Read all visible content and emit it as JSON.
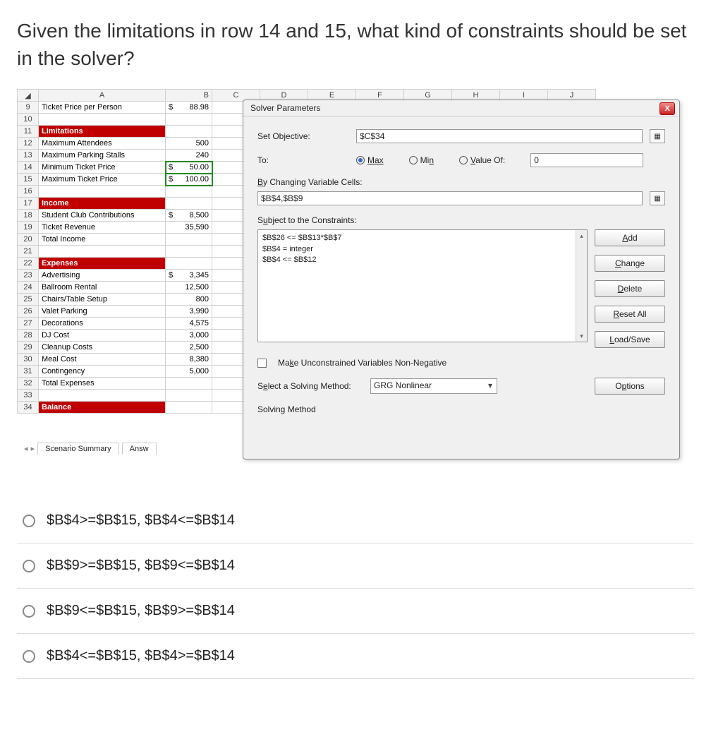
{
  "question": "Given the limitations in row 14 and 15, what kind of constraints should be set in the solver?",
  "columns": [
    "A",
    "B",
    "C",
    "D",
    "E",
    "F",
    "G",
    "H",
    "I",
    "J"
  ],
  "rows": [
    {
      "n": 9,
      "a": "Ticket Price per Person",
      "p": "$",
      "b": "88.98"
    },
    {
      "n": 10,
      "a": "",
      "b": ""
    },
    {
      "n": 11,
      "a": "Limitations",
      "sect": true,
      "b": ""
    },
    {
      "n": 12,
      "a": "Maximum Attendees",
      "b": "500"
    },
    {
      "n": 13,
      "a": "Maximum Parking Stalls",
      "b": "240"
    },
    {
      "n": 14,
      "a": "Minimum Ticket Price",
      "p": "$",
      "b": "50.00",
      "sel": true
    },
    {
      "n": 15,
      "a": "Maximum Ticket Price",
      "p": "$",
      "b": "100.00",
      "sel": true
    },
    {
      "n": 16,
      "a": "",
      "b": ""
    },
    {
      "n": 17,
      "a": "Income",
      "sect": true,
      "b": ""
    },
    {
      "n": 18,
      "a": "Student Club Contributions",
      "p": "$",
      "b": "8,500"
    },
    {
      "n": 19,
      "a": "Ticket Revenue",
      "b": "35,590"
    },
    {
      "n": 20,
      "a": "   Total Income",
      "b": ""
    },
    {
      "n": 21,
      "a": "",
      "b": ""
    },
    {
      "n": 22,
      "a": "Expenses",
      "sect": true,
      "b": ""
    },
    {
      "n": 23,
      "a": "Advertising",
      "p": "$",
      "b": "3,345"
    },
    {
      "n": 24,
      "a": "Ballroom Rental",
      "b": "12,500"
    },
    {
      "n": 25,
      "a": "Chairs/Table Setup",
      "b": "800"
    },
    {
      "n": 26,
      "a": "Valet Parking",
      "b": "3,990"
    },
    {
      "n": 27,
      "a": "Decorations",
      "b": "4,575"
    },
    {
      "n": 28,
      "a": "DJ Cost",
      "b": "3,000"
    },
    {
      "n": 29,
      "a": "Cleanup Costs",
      "b": "2,500"
    },
    {
      "n": 30,
      "a": "Meal Cost",
      "b": "8,380"
    },
    {
      "n": 31,
      "a": "Contingency",
      "b": "5,000"
    },
    {
      "n": 32,
      "a": "   Total Expenses",
      "b": ""
    },
    {
      "n": 33,
      "a": "",
      "b": ""
    },
    {
      "n": 34,
      "a": "Balance",
      "sect": true,
      "b": ""
    }
  ],
  "tabs": {
    "tab1": "Scenario Summary",
    "tab2": "Answ"
  },
  "dialog": {
    "title": "Solver Parameters",
    "set_objective_label": "Set Objective:",
    "set_objective_value": "$C$34",
    "to_label": "To:",
    "max": "Max",
    "min": "Min",
    "valueof": "Value Of:",
    "valueof_val": "0",
    "bychanging": "By Changing Variable Cells:",
    "bychanging_val": "$B$4,$B$9",
    "subject": "Subject to the Constraints:",
    "constraints": [
      "$B$26 <= $B$13*$B$7",
      "$B$4 = integer",
      "$B$4 <= $B$12"
    ],
    "make_unc": "Make Unconstrained Variables Non-Negative",
    "select_method_label": "Select a Solving Method:",
    "select_method_value": "GRG Nonlinear",
    "solving_method": "Solving Method",
    "btn_add": "Add",
    "btn_change": "Change",
    "btn_delete": "Delete",
    "btn_reset": "Reset All",
    "btn_load": "Load/Save",
    "btn_options": "Options"
  },
  "answers": {
    "a": "$B$4>=$B$15, $B$4<=$B$14",
    "b": "$B$9>=$B$15, $B$9<=$B$14",
    "c": "$B$9<=$B$15, $B$9>=$B$14",
    "d": "$B$4<=$B$15, $B$4>=$B$14"
  }
}
